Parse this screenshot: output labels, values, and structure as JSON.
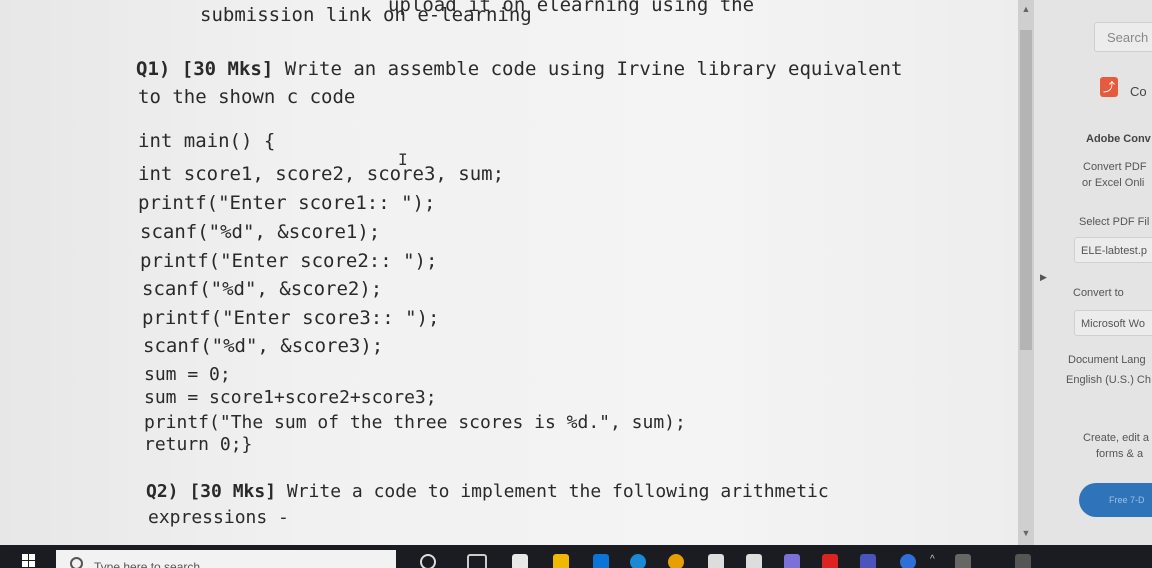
{
  "document": {
    "lines": [
      "upload it on elearning using the",
      "submission link on e-learning",
      "to the shown c code",
      "int main() {",
      "int score1, score2, score3, sum;",
      "printf(\"Enter score1:: \");",
      "scanf(\"%d\", &score1);",
      "printf(\"Enter score2:: \");",
      "scanf(\"%d\", &score2);",
      "printf(\"Enter score3:: \");",
      "scanf(\"%d\", &score3);",
      "sum = 0;",
      "sum = score1+score2+score3;",
      "printf(\"The sum of the three scores is %d.\", sum);",
      "return 0;}",
      "expressions -"
    ],
    "q1_marks": "Q1) [30 Mks]",
    "q1_text": " Write an assemble code using Irvine library equivalent",
    "q2_marks": "Q2) [30 Mks]",
    "q2_text": " Write a code to implement the following arithmetic"
  },
  "panel": {
    "search_placeholder": "Search",
    "convert_title": "Co",
    "adobe_heading": "Adobe Conv",
    "convert_desc_1": "Convert PDF",
    "convert_desc_2": "or Excel Onli",
    "select_label": "Select PDF Fil",
    "file_name": "ELE-labtest.p",
    "convert_to_label": "Convert to",
    "target_format": "Microsoft Wo",
    "doc_lang_label": "Document Lang",
    "doc_lang_value": "English (U.S.)  Ch",
    "create_line1": "Create, edit a",
    "create_line2": "forms & a",
    "free_button": "Free 7-D"
  },
  "taskbar": {
    "search_placeholder": "Type here to search"
  }
}
